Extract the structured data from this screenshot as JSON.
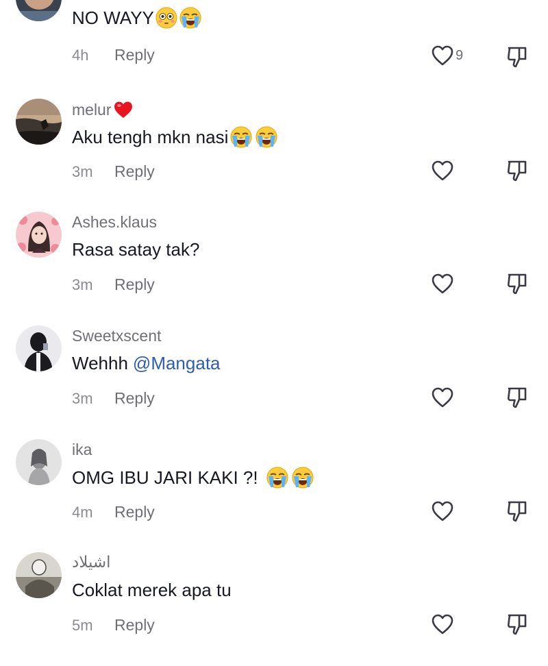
{
  "comments": [
    {
      "username": "",
      "text": "NO WAYY",
      "emojis": [
        "flushed-face",
        "loudly-crying-face"
      ],
      "time": "4h",
      "reply_label": "Reply",
      "likes": "9"
    },
    {
      "username": "melur",
      "username_emoji": "red-heart",
      "text": "Aku tengh mkn nasi",
      "emojis": [
        "loudly-crying-face",
        "loudly-crying-face"
      ],
      "time": "3m",
      "reply_label": "Reply",
      "likes": ""
    },
    {
      "username": "Ashes.klaus",
      "text": "Rasa satay tak?",
      "emojis": [],
      "time": "3m",
      "reply_label": "Reply",
      "likes": ""
    },
    {
      "username": "Sweetxscent",
      "text": "Wehhh",
      "mention": "@Mangata",
      "emojis": [],
      "time": "3m",
      "reply_label": "Reply",
      "likes": ""
    },
    {
      "username": "ika",
      "text": "OMG IBU JARI KAKI ?!",
      "emojis": [
        "loudly-crying-face",
        "loudly-crying-face"
      ],
      "time": "4m",
      "reply_label": "Reply",
      "likes": ""
    },
    {
      "username": "اشيلاد",
      "text": "Coklat merek apa tu",
      "emojis": [],
      "time": "5m",
      "reply_label": "Reply",
      "likes": ""
    }
  ],
  "colors": {
    "text": "#161823",
    "secondary": "#6f6f76",
    "mention": "#2b5db5",
    "background": "#ffffff"
  }
}
